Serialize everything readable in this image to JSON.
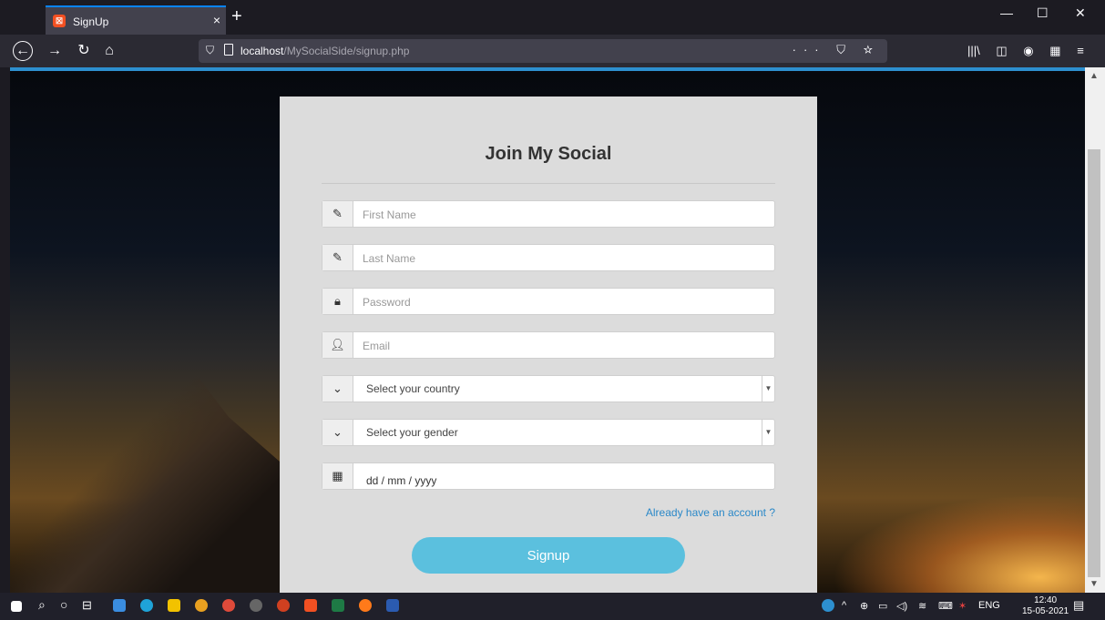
{
  "browser": {
    "tab_title": "SignUp",
    "tab_close": "×",
    "new_tab": "+",
    "url_host": "localhost",
    "url_path": "/MySocialSide/signup.php",
    "url_icons": "··· ⛉ ☆",
    "toolbar_icons": [
      "|||\\",
      "◫",
      "◉",
      "▦",
      "≡"
    ],
    "window_controls": [
      "—",
      "☐",
      "✕"
    ]
  },
  "form": {
    "title": "Join My Social",
    "first_name_placeholder": "First Name",
    "last_name_placeholder": "Last Name",
    "password_placeholder": "Password",
    "email_placeholder": "Email",
    "country_select": "Select your country",
    "gender_select": "Select your gender",
    "date_placeholder": "dd / mm / yyyy",
    "login_link": "Already have an account ?",
    "signup_button": "Signup"
  },
  "taskbar": {
    "language": "ENG",
    "time": "12:40",
    "date": "15-05-2021"
  },
  "colors": {
    "accent": "#5bc0de",
    "link": "#2a88c8",
    "card_bg": "#dcdcdc"
  }
}
